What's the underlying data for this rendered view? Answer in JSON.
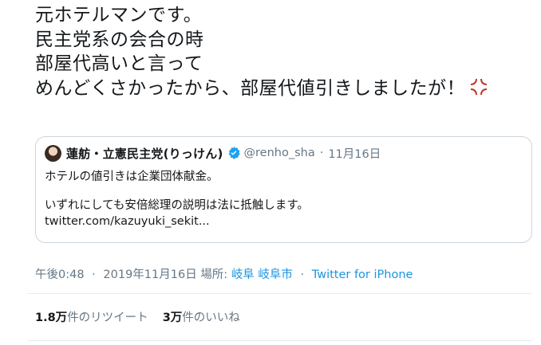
{
  "tweet": {
    "lines": [
      "元ホテルマンです。",
      "民主党系の会合の時",
      "部屋代高いと言って",
      "めんどくさかったから、部屋代値引きしましたが！"
    ],
    "trailing_emoji": "anger-symbol"
  },
  "quote": {
    "name": "蓮舫・立憲民主党(りっけん)",
    "handle": "@renho_sha",
    "separator": "·",
    "date": "11月16日",
    "verified": true,
    "body": {
      "line1": "ホテルの値引きは企業団体献金。",
      "line2": "いずれにしても安倍総理の説明は法に抵触します。",
      "line3": "twitter.com/kazuyuki_sekit..."
    }
  },
  "meta": {
    "time": "午後0:48",
    "date": "2019年11月16日",
    "location_prefix": "場所:",
    "location": "岐阜 岐阜市",
    "source": "Twitter for iPhone",
    "separator": "·"
  },
  "stats": {
    "retweets_count": "1.8万",
    "retweets_label": "件のリツイート",
    "likes_count": "3万",
    "likes_label": "件のいいね"
  },
  "colors": {
    "text": "#14171a",
    "secondary": "#657786",
    "link": "#1b95e0",
    "border": "#ccd6dd",
    "anger": "#c0392b"
  }
}
